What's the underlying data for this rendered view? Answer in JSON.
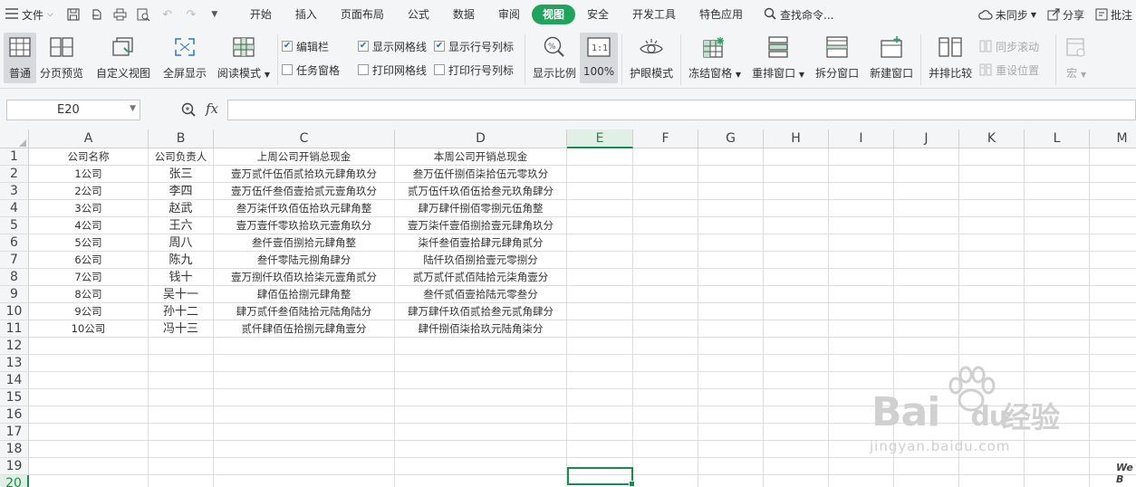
{
  "menubar": {
    "file_label": "文件",
    "tabs": [
      "开始",
      "插入",
      "页面布局",
      "公式",
      "数据",
      "审阅",
      "视图",
      "安全",
      "开发工具",
      "特色应用"
    ],
    "active_tab": "视图",
    "search_label": "查找命令...",
    "sync_label": "未同步",
    "share_label": "分享",
    "batch_label": "批注"
  },
  "ribbon": {
    "normal": "普通",
    "page_break": "分页预览",
    "custom_view": "自定义视图",
    "fullscreen": "全屏显示",
    "reading_mode": "阅读模式",
    "formula_bar": "编辑栏",
    "task_pane": "任务窗格",
    "show_gridlines": "显示网格线",
    "print_gridlines": "打印网格线",
    "show_headings": "显示行号列标",
    "print_headings": "打印行号列标",
    "zoom": "显示比例",
    "zoom_100": "100%",
    "eye_mode": "护眼模式",
    "freeze": "冻结窗格",
    "arrange": "重排窗口",
    "split": "拆分窗口",
    "new_window": "新建窗口",
    "side_by_side": "并排比较",
    "sync_scroll": "同步滚动",
    "reset_position": "重设位置",
    "macro": "宏"
  },
  "formula_bar": {
    "name_box": "E20",
    "fx_label": "fx",
    "content": ""
  },
  "grid": {
    "columns": [
      "A",
      "B",
      "C",
      "D",
      "E",
      "F",
      "G",
      "H",
      "I",
      "J",
      "K",
      "L",
      "M"
    ],
    "row_numbers": [
      "1",
      "2",
      "3",
      "4",
      "5",
      "6",
      "7",
      "8",
      "9",
      "10",
      "11",
      "12",
      "13",
      "14",
      "15",
      "16",
      "17",
      "18",
      "19",
      "20"
    ],
    "selected_column": "E",
    "selected_row": "20",
    "header": [
      "公司名称",
      "公司负责人",
      "上周公司开销总现金",
      "本周公司开销总现金"
    ],
    "rows": [
      [
        "1公司",
        "张三",
        "壹万贰仟伍佰贰拾玖元肆角玖分",
        "叁万伍仟捌佰柒拾伍元零玖分"
      ],
      [
        "2公司",
        "李四",
        "壹万伍仟叁佰壹拾贰元壹角玖分",
        "贰万伍仟玖佰伍拾叁元玖角肆分"
      ],
      [
        "3公司",
        "赵武",
        "叁万柒仟玖佰伍拾玖元肆角整",
        "肆万肆仟捌佰零捌元伍角整"
      ],
      [
        "4公司",
        "王六",
        "壹万壹仟零玖拾玖元壹角玖分",
        "壹万柒仟壹佰捌拾壹元肆角玖分"
      ],
      [
        "5公司",
        "周八",
        "叁仟壹佰捌拾元肆角整",
        "柒仟叁佰壹拾肆元肆角贰分"
      ],
      [
        "6公司",
        "陈九",
        "叁仟零陆元捌角肆分",
        "陆仟玖佰捌拾壹元零捌分"
      ],
      [
        "7公司",
        "钱十",
        "壹万捌仟玖佰玖拾柒元壹角贰分",
        "贰万贰仟贰佰陆拾元柒角壹分"
      ],
      [
        "8公司",
        "吴十一",
        "肆佰伍拾捌元肆角整",
        "叁仟贰佰壹拾陆元零叁分"
      ],
      [
        "9公司",
        "孙十二",
        "肆万贰仟叁佰陆拾元陆角陆分",
        "肆万肆仟玖佰贰拾叁元贰角肆分"
      ],
      [
        "10公司",
        "冯十三",
        "贰仟肆佰伍拾捌元肆角壹分",
        "肆仟捌佰柒拾玖元陆角柒分"
      ]
    ]
  },
  "watermark": {
    "brand": "Bai",
    "brand2": "du",
    "cn": "经验",
    "url": "jingyan.baidu.com"
  }
}
